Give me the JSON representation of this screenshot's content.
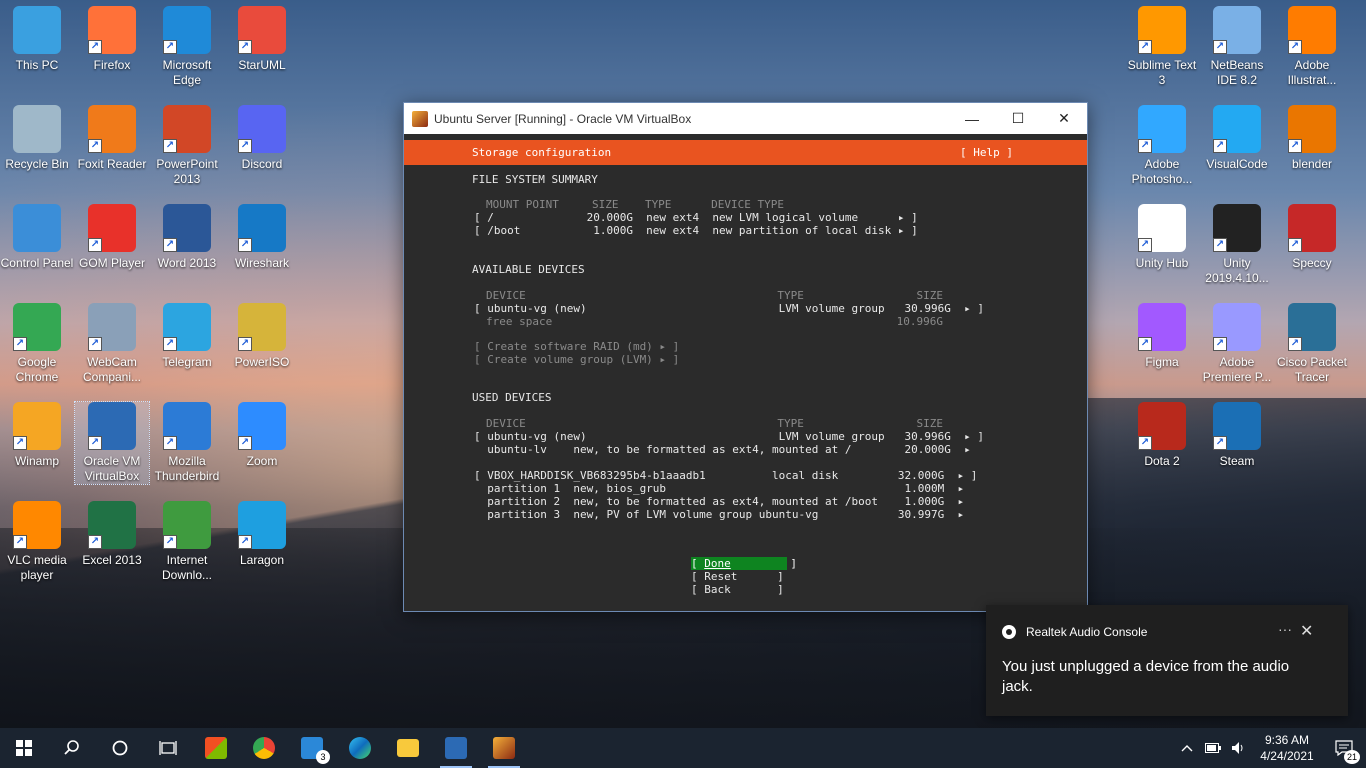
{
  "desktop": {
    "icons_left": [
      {
        "label": "This PC",
        "icon": "computer-icon",
        "color": "#3aa0e0"
      },
      {
        "label": "Firefox",
        "icon": "firefox-icon",
        "color": "#ff7139"
      },
      {
        "label": "Microsoft Edge",
        "icon": "edge-icon",
        "color": "#1f8ad8"
      },
      {
        "label": "StarUML",
        "icon": "staruml-icon",
        "color": "#e94b3c"
      },
      {
        "label": "Recycle Bin",
        "icon": "recycle-bin-icon",
        "color": "#9fb8c9"
      },
      {
        "label": "Foxit Reader",
        "icon": "foxit-icon",
        "color": "#f07a1a"
      },
      {
        "label": "PowerPoint 2013",
        "icon": "powerpoint-icon",
        "color": "#d24726"
      },
      {
        "label": "Discord",
        "icon": "discord-icon",
        "color": "#5865f2"
      },
      {
        "label": "Control Panel",
        "icon": "control-panel-icon",
        "color": "#3b8ed8"
      },
      {
        "label": "GOM Player",
        "icon": "gom-player-icon",
        "color": "#e8312a"
      },
      {
        "label": "Word 2013",
        "icon": "word-icon",
        "color": "#2b5797"
      },
      {
        "label": "Wireshark",
        "icon": "wireshark-icon",
        "color": "#1679c6"
      },
      {
        "label": "Google Chrome",
        "icon": "chrome-icon",
        "color": "#34a853"
      },
      {
        "label": "WebCam Compani...",
        "icon": "webcam-icon",
        "color": "#8aa0b8"
      },
      {
        "label": "Telegram",
        "icon": "telegram-icon",
        "color": "#2ca5e0"
      },
      {
        "label": "PowerISO",
        "icon": "poweriso-icon",
        "color": "#d6b43a"
      },
      {
        "label": "Winamp",
        "icon": "winamp-icon",
        "color": "#f5a623"
      },
      {
        "label": "Oracle VM VirtualBox",
        "icon": "virtualbox-icon",
        "color": "#2c6ab4"
      },
      {
        "label": "Mozilla Thunderbird",
        "icon": "thunderbird-icon",
        "color": "#2c7bd6"
      },
      {
        "label": "Zoom",
        "icon": "zoom-icon",
        "color": "#2d8cff"
      },
      {
        "label": "VLC media player",
        "icon": "vlc-icon",
        "color": "#ff8800"
      },
      {
        "label": "Excel 2013",
        "icon": "excel-icon",
        "color": "#207245"
      },
      {
        "label": "Internet Downlo...",
        "icon": "idm-icon",
        "color": "#3f9b3f"
      },
      {
        "label": "Laragon",
        "icon": "laragon-icon",
        "color": "#1e9fe0"
      }
    ],
    "icons_right": [
      {
        "label": "Sublime Text 3",
        "icon": "sublime-icon",
        "color": "#ff9800"
      },
      {
        "label": "NetBeans IDE 8.2",
        "icon": "netbeans-icon",
        "color": "#7ab0e6"
      },
      {
        "label": "Adobe Illustrat...",
        "icon": "illustrator-icon",
        "color": "#ff7c00"
      },
      {
        "label": "Adobe Photosho...",
        "icon": "photoshop-icon",
        "color": "#31a8ff"
      },
      {
        "label": "VisualCode",
        "icon": "vscode-icon",
        "color": "#23a9f2"
      },
      {
        "label": "blender",
        "icon": "blender-icon",
        "color": "#ea7600"
      },
      {
        "label": "Unity Hub",
        "icon": "unity-hub-icon",
        "color": "#ffffff"
      },
      {
        "label": "Unity 2019.4.10...",
        "icon": "unity-icon",
        "color": "#222222"
      },
      {
        "label": "Speccy",
        "icon": "speccy-icon",
        "color": "#c62828"
      },
      {
        "label": "Figma",
        "icon": "figma-icon",
        "color": "#a259ff"
      },
      {
        "label": "Adobe Premiere P...",
        "icon": "premiere-icon",
        "color": "#9999ff"
      },
      {
        "label": "Cisco Packet Tracer",
        "icon": "packet-tracer-icon",
        "color": "#2a6f97"
      },
      {
        "label": "Dota 2",
        "icon": "dota-icon",
        "color": "#b8291c"
      },
      {
        "label": "Steam",
        "icon": "steam-icon",
        "color": "#1b6fb5"
      }
    ]
  },
  "vbox_window": {
    "title": "Ubuntu Server [Running] - Oracle VM VirtualBox",
    "minimize": "—",
    "maximize": "☐",
    "close": "✕"
  },
  "installer": {
    "header_title": "Storage configuration",
    "help": "[ Help ]",
    "fs_summary_heading": "FILE SYSTEM SUMMARY",
    "fs_header": "MOUNT POINT     SIZE    TYPE      DEVICE TYPE",
    "fs_rows": [
      "[ /              20.000G  new ext4  new LVM logical volume      ▸ ]",
      "[ /boot           1.000G  new ext4  new partition of local disk ▸ ]"
    ],
    "avail_heading": "AVAILABLE DEVICES",
    "avail_header": "DEVICE                                      TYPE                 SIZE",
    "avail_rows": [
      "[ ubuntu-vg (new)                             LVM volume group   30.996G  ▸ ]"
    ],
    "avail_free": "free space                                                    10.996G",
    "avail_actions": [
      "[ Create software RAID (md) ▸ ]",
      "[ Create volume group (LVM) ▸ ]"
    ],
    "used_heading": "USED DEVICES",
    "used_header": "DEVICE                                      TYPE                 SIZE",
    "used_rows": [
      "[ ubuntu-vg (new)                             LVM volume group   30.996G  ▸ ]",
      "  ubuntu-lv    new, to be formatted as ext4, mounted at /        20.000G  ▸",
      "",
      "[ VBOX_HARDDISK_VB683295b4-b1aaadb1          local disk         32.000G  ▸ ]",
      "  partition 1  new, bios_grub                                    1.000M  ▸",
      "  partition 2  new, to be formatted as ext4, mounted at /boot    1.000G  ▸",
      "  partition 3  new, PV of LVM volume group ubuntu-vg            30.997G  ▸"
    ],
    "btn_done": "Done",
    "btn_reset": "[ Reset      ]",
    "btn_back": "[ Back       ]"
  },
  "notification": {
    "app": "Realtek Audio Console",
    "message": "You just unplugged a device from the audio jack.",
    "more": "···",
    "close": "✕"
  },
  "taskbar": {
    "time": "9:36 AM",
    "date": "4/24/2021",
    "mail_badge": "3",
    "notif_badge": "21"
  }
}
